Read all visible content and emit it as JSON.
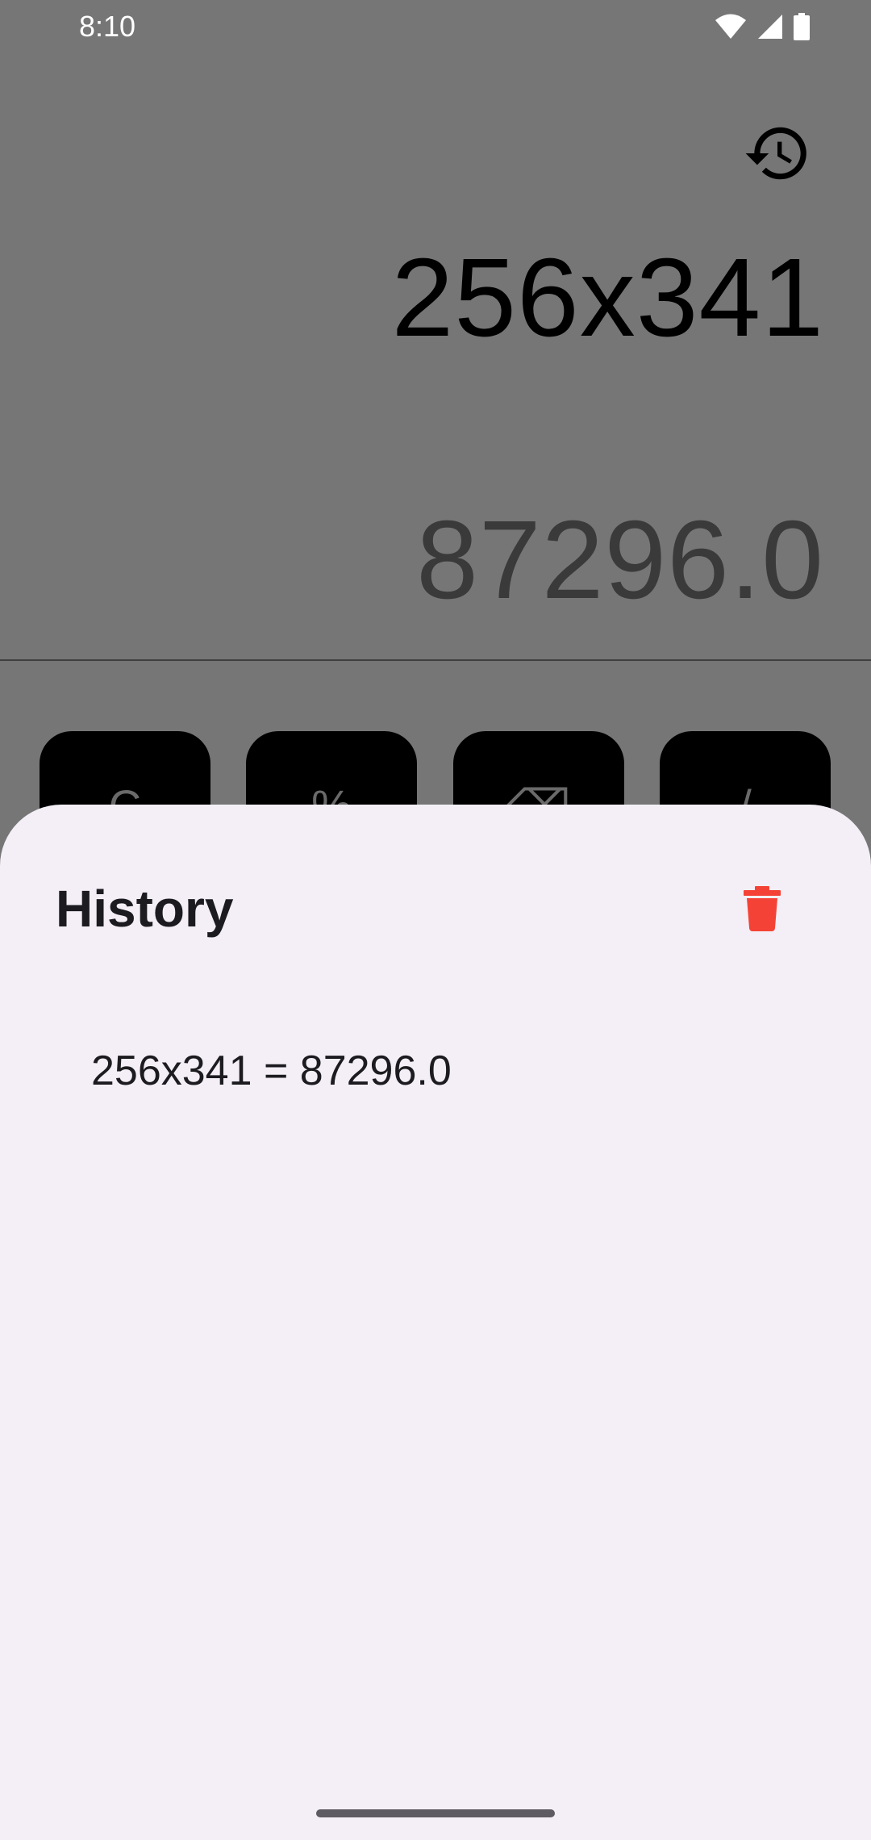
{
  "status_bar": {
    "time": "8:10",
    "icons": [
      "wifi-icon",
      "signal-icon",
      "battery-icon"
    ]
  },
  "calculator": {
    "history_icon": "history-icon",
    "expression": "256x341",
    "result": "87296.0",
    "visible_keys": [
      "C",
      "%",
      "⌫",
      "/"
    ]
  },
  "history_sheet": {
    "title": "History",
    "delete_icon": "trash-icon",
    "delete_color": "#f44336",
    "items": [
      {
        "text": "256x341 = 87296.0"
      }
    ]
  },
  "colors": {
    "scrim_background": "#767676",
    "sheet_background": "#f4eff7",
    "key_background": "#000000"
  }
}
